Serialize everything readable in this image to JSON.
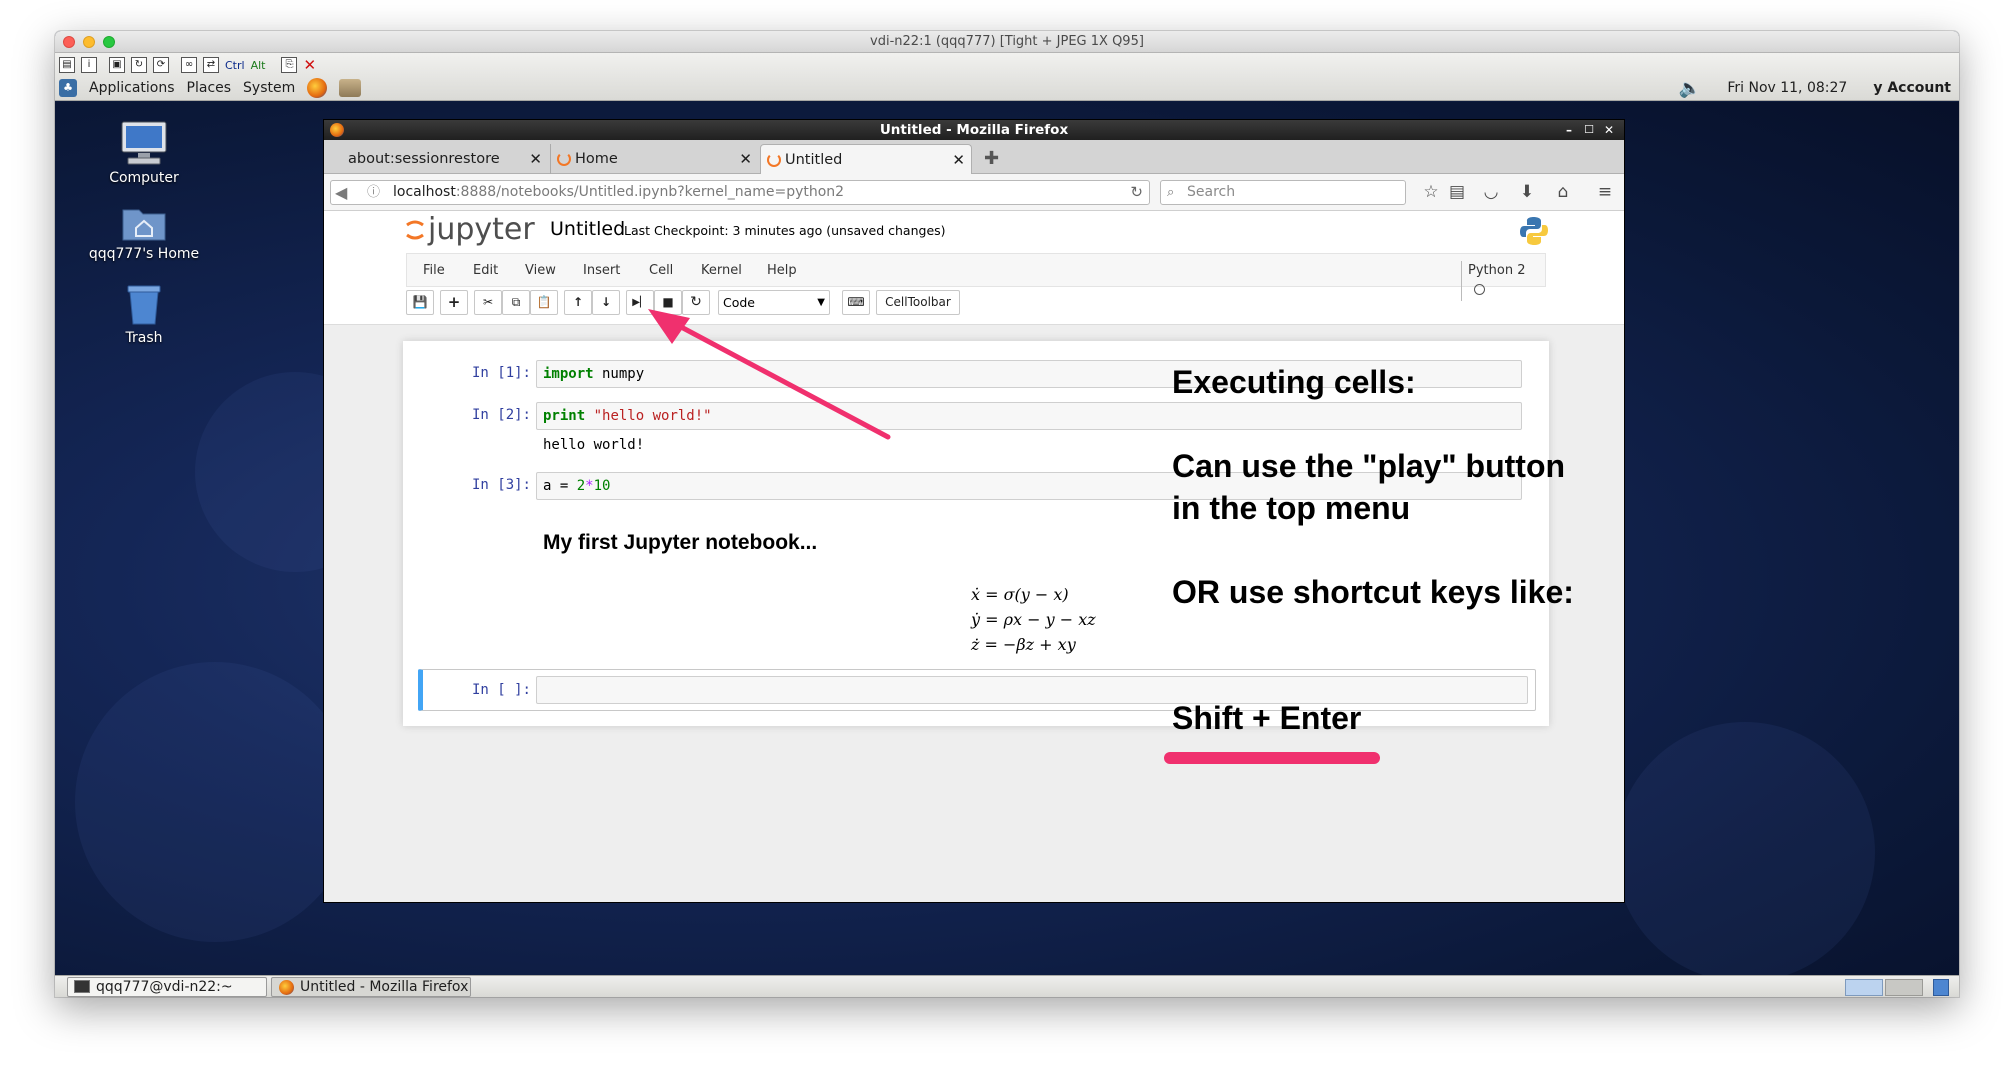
{
  "vnc": {
    "title": "vdi-n22:1 (qqq777) [Tight + JPEG 1X Q95]"
  },
  "gnome": {
    "menu": [
      "Applications",
      "Places",
      "System"
    ],
    "toolbar_ctrl": "Ctrl",
    "toolbar_alt": "Alt",
    "clock": "Fri Nov 11, 08:27",
    "account": "y Account"
  },
  "desktop": {
    "icons": [
      {
        "label": "Computer",
        "icon": "computer-icon"
      },
      {
        "label": "qqq777's Home",
        "icon": "home-folder-icon"
      },
      {
        "label": "Trash",
        "icon": "trash-icon"
      }
    ]
  },
  "firefox": {
    "title": "Untitled - Mozilla Firefox",
    "tabs": [
      {
        "label": "about:sessionrestore"
      },
      {
        "label": "Home"
      },
      {
        "label": "Untitled"
      }
    ],
    "url_host": "localhost",
    "url_rest": ":8888/notebooks/Untitled.ipynb?kernel_name=python2",
    "search_placeholder": "Search"
  },
  "jupyter": {
    "logo_text": "jupyter",
    "notebook_name": "Untitled",
    "checkpoint": "Last Checkpoint: 3 minutes ago (unsaved changes)",
    "menu": [
      "File",
      "Edit",
      "View",
      "Insert",
      "Cell",
      "Kernel",
      "Help"
    ],
    "kernel": "Python 2",
    "cell_type": "Code",
    "celltoolbar": "CellToolbar",
    "cells": [
      {
        "prompt": "In [1]:",
        "code_kw": "import",
        "code_rest": " numpy"
      },
      {
        "prompt": "In [2]:",
        "code_kw": "print",
        "code_str": " \"hello world!\"",
        "output": "hello world!"
      },
      {
        "prompt": "In [3]:",
        "code_a": "a = ",
        "code_num": "2",
        "code_op": "*",
        "code_num2": "10"
      },
      {
        "prompt": "In [ ]:"
      }
    ],
    "markdown_heading": "My first Jupyter notebook...",
    "equations": [
      "ẋ = σ(y − x)",
      "ẏ = ρx − y − xz",
      "ż = −βz + xy"
    ]
  },
  "taskbar": {
    "items": [
      "qqq777@vdi-n22:~",
      "Untitled - Mozilla Firefox"
    ]
  },
  "annotations": {
    "line1": "Executing cells:",
    "line2": "Can use the \"play\" button",
    "line3": "in the top menu",
    "line4": "OR use shortcut keys like:",
    "line5": "Shift + Enter",
    "arrow_color": "#f0306e"
  }
}
